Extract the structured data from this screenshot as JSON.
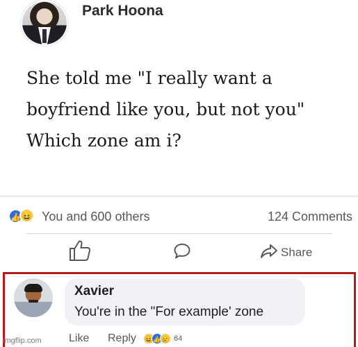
{
  "post": {
    "author": "Park Hoona",
    "text_lines": [
      "She told me \"I really want a",
      "boyfriend like you, but not you\"",
      "Which zone am i?"
    ],
    "reactions_summary": "You and 600 others",
    "comments_count": "124 Comments",
    "share_label": "Share"
  },
  "comment": {
    "author": "Xavier",
    "text": "You're in the \"For example' zone",
    "like_label": "Like",
    "reply_label": "Reply",
    "reaction_count": "64"
  },
  "watermark": "imgflip.com",
  "colors": {
    "highlight_border": "#b31b1b",
    "like_blue": "#2d6ce2",
    "haha_yellow": "#f7c84a",
    "bubble_bg": "#f0f2f5"
  }
}
